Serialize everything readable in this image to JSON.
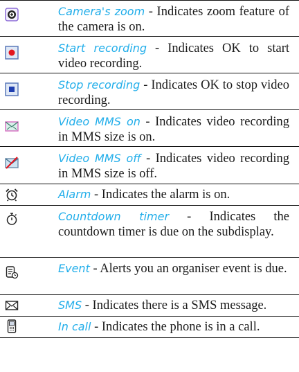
{
  "items": [
    {
      "icon": "camera-zoom-icon",
      "term": "Camera's zoom",
      "sep": " - ",
      "desc": "Indicates zoom feature of the camera is on."
    },
    {
      "icon": "start-recording-icon",
      "term": "Start recording",
      "sep": " - ",
      "desc": "Indicates OK to start video recording."
    },
    {
      "icon": "stop-recording-icon",
      "term": "Stop recording",
      "sep": " - ",
      "desc": "Indicates OK to stop video recording."
    },
    {
      "icon": "video-mms-on-icon",
      "term": "Video MMS on",
      "sep": " - ",
      "desc": "Indicates video recording in MMS size is on."
    },
    {
      "icon": "video-mms-off-icon",
      "term": "Video MMS off",
      "sep": " - ",
      "desc": "Indicates video recording in MMS size is off."
    },
    {
      "icon": "alarm-clock-icon",
      "term": "Alarm",
      "sep": " - ",
      "desc": "Indicates the alarm is on."
    },
    {
      "icon": "stopwatch-icon",
      "term": "Countdown timer",
      "sep": " - ",
      "desc": "Indicates the countdown timer is due on the subdisplay."
    },
    {
      "icon": "event-icon",
      "term": "Event",
      "sep": " - ",
      "desc": "Alerts you an organiser event is due."
    },
    {
      "icon": "envelope-icon",
      "term": "SMS",
      "sep": " - ",
      "desc": "Indicates there is a SMS message."
    },
    {
      "icon": "phone-in-call-icon",
      "term": "In call",
      "sep": " - ",
      "desc": "Indicates the phone is in a call."
    }
  ],
  "colors": {
    "term": "#22aeea",
    "text": "#1a1a1a",
    "rule": "#111111"
  }
}
